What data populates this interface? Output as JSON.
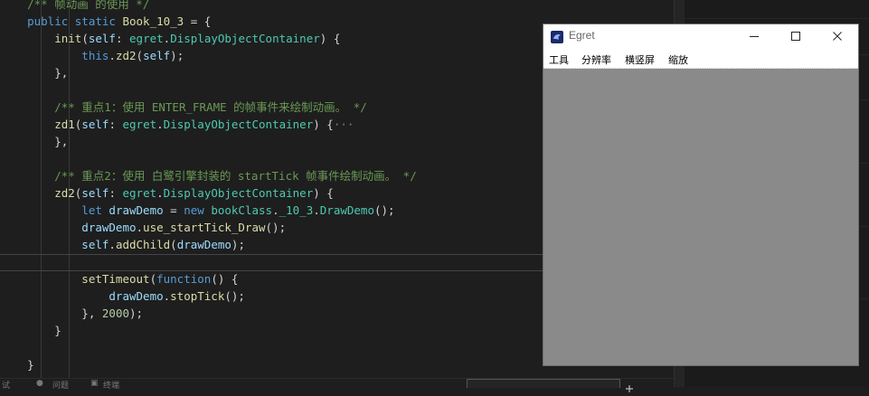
{
  "editor": {
    "lines": [
      [
        [
          "c-cm",
          "    /** 帧动画 的使用 */"
        ]
      ],
      [
        [
          "c-kw",
          "    public static "
        ],
        [
          "c-fn",
          "Book_10_3"
        ],
        [
          "c-pl",
          " = {"
        ]
      ],
      [
        [
          "c-fn",
          "        init"
        ],
        [
          "c-pl",
          "("
        ],
        [
          "c-var",
          "self"
        ],
        [
          "c-pl",
          ": "
        ],
        [
          "c-cls",
          "egret"
        ],
        [
          "c-pl",
          "."
        ],
        [
          "c-cls",
          "DisplayObjectContainer"
        ],
        [
          "c-pl",
          ") {"
        ]
      ],
      [
        [
          "c-kw",
          "            this"
        ],
        [
          "c-pl",
          "."
        ],
        [
          "c-fn",
          "zd2"
        ],
        [
          "c-pl",
          "("
        ],
        [
          "c-var",
          "self"
        ],
        [
          "c-pl",
          ");"
        ]
      ],
      [
        [
          "c-pl",
          "        },"
        ]
      ],
      [
        [
          "c-pl",
          ""
        ]
      ],
      [
        [
          "c-cm",
          "        /** 重点1：使用 ENTER_FRAME 的帧事件来绘制动画。 */"
        ]
      ],
      [
        [
          "c-fn",
          "        zd1"
        ],
        [
          "c-pl",
          "("
        ],
        [
          "c-var",
          "self"
        ],
        [
          "c-pl",
          ": "
        ],
        [
          "c-cls",
          "egret"
        ],
        [
          "c-pl",
          "."
        ],
        [
          "c-cls",
          "DisplayObjectContainer"
        ],
        [
          "c-pl",
          ") {"
        ],
        [
          "c-gr",
          "···"
        ]
      ],
      [
        [
          "c-pl",
          "        },"
        ]
      ],
      [
        [
          "c-pl",
          ""
        ]
      ],
      [
        [
          "c-cm",
          "        /** 重点2：使用 白鹭引擎封装的 startTick 帧事件绘制动画。 */"
        ]
      ],
      [
        [
          "c-fn",
          "        zd2"
        ],
        [
          "c-pl",
          "("
        ],
        [
          "c-var",
          "self"
        ],
        [
          "c-pl",
          ": "
        ],
        [
          "c-cls",
          "egret"
        ],
        [
          "c-pl",
          "."
        ],
        [
          "c-cls",
          "DisplayObjectContainer"
        ],
        [
          "c-pl",
          ") {"
        ]
      ],
      [
        [
          "c-kw",
          "            let "
        ],
        [
          "c-var",
          "drawDemo"
        ],
        [
          "c-pl",
          " = "
        ],
        [
          "c-kw",
          "new "
        ],
        [
          "c-cls",
          "bookClass"
        ],
        [
          "c-pl",
          "."
        ],
        [
          "c-cls",
          "_10_3"
        ],
        [
          "c-pl",
          "."
        ],
        [
          "c-cls",
          "DrawDemo"
        ],
        [
          "c-pl",
          "();"
        ]
      ],
      [
        [
          "c-var",
          "            drawDemo"
        ],
        [
          "c-pl",
          "."
        ],
        [
          "c-fn",
          "use_startTick_Draw"
        ],
        [
          "c-pl",
          "();"
        ]
      ],
      [
        [
          "c-var",
          "            self"
        ],
        [
          "c-pl",
          "."
        ],
        [
          "c-fn",
          "addChild"
        ],
        [
          "c-pl",
          "("
        ],
        [
          "c-var",
          "drawDemo"
        ],
        [
          "c-pl",
          ");"
        ]
      ],
      [
        [
          "c-pl",
          ""
        ]
      ],
      [
        [
          "c-fn",
          "            setTimeout"
        ],
        [
          "c-pl",
          "("
        ],
        [
          "c-kw",
          "function"
        ],
        [
          "c-pl",
          "() {"
        ]
      ],
      [
        [
          "c-var",
          "                drawDemo"
        ],
        [
          "c-pl",
          "."
        ],
        [
          "c-fn",
          "stopTick"
        ],
        [
          "c-pl",
          "();"
        ]
      ],
      [
        [
          "c-pl",
          "            }, "
        ],
        [
          "c-num",
          "2000"
        ],
        [
          "c-pl",
          ");"
        ]
      ],
      [
        [
          "c-pl",
          "        }"
        ]
      ],
      [
        [
          "c-pl",
          ""
        ]
      ],
      [
        [
          "c-pl",
          "    }"
        ]
      ]
    ]
  },
  "bottom_bar": {
    "items": [
      "试",
      "问题",
      "终端"
    ]
  },
  "egret_window": {
    "title": "Egret",
    "menu": [
      "工具",
      "分辨率",
      "横竖屏",
      "缩放"
    ],
    "canvas_color": "#8a8a8a"
  }
}
